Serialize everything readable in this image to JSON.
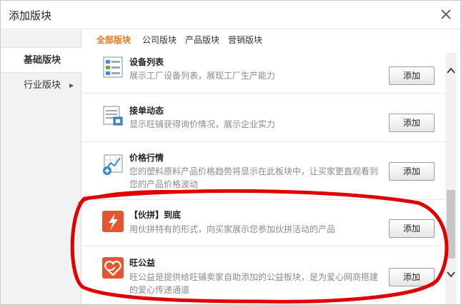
{
  "dialog": {
    "title": "添加版块",
    "close_icon": "close-icon"
  },
  "sidebar": {
    "items": [
      {
        "label": "基础版块",
        "active": true
      },
      {
        "label": "行业版块",
        "active": false,
        "has_submenu": true
      }
    ]
  },
  "tabs": [
    {
      "label": "全部版块",
      "active": true
    },
    {
      "label": "公司版块",
      "active": false
    },
    {
      "label": "产品版块",
      "active": false
    },
    {
      "label": "营销版块",
      "active": false
    }
  ],
  "modules": [
    {
      "name": "设备列表",
      "description": "展示工厂设备列表，展现工厂生产能力",
      "button": "添加",
      "icon": "equipment-list-icon"
    },
    {
      "name": "接单动态",
      "description": "显示旺铺获得询价情况，展示企业实力",
      "button": "添加",
      "icon": "order-activity-icon"
    },
    {
      "name": "价格行情",
      "description": "您的塑料原料产品价格趋势将显示在此板块中，让买家更直观看到您的产品价格波动",
      "button": "添加",
      "icon": "price-trend-icon"
    },
    {
      "name": "【伙拼】到底",
      "description": "用伙拼特有的形式，向买家展示您参加伙拼活动的产品",
      "button": "添加",
      "icon": "lightning-icon"
    },
    {
      "name": "旺公益",
      "description": "旺公益是提供给旺铺卖家自助添加的公益板块，是为爱心网商搭建的爱心传递通道",
      "button": "添加",
      "icon": "heart-hand-icon"
    }
  ],
  "colors": {
    "tab_active": "#e8731c",
    "annotation": "#e00000",
    "icon_orange": "#e4572e"
  }
}
